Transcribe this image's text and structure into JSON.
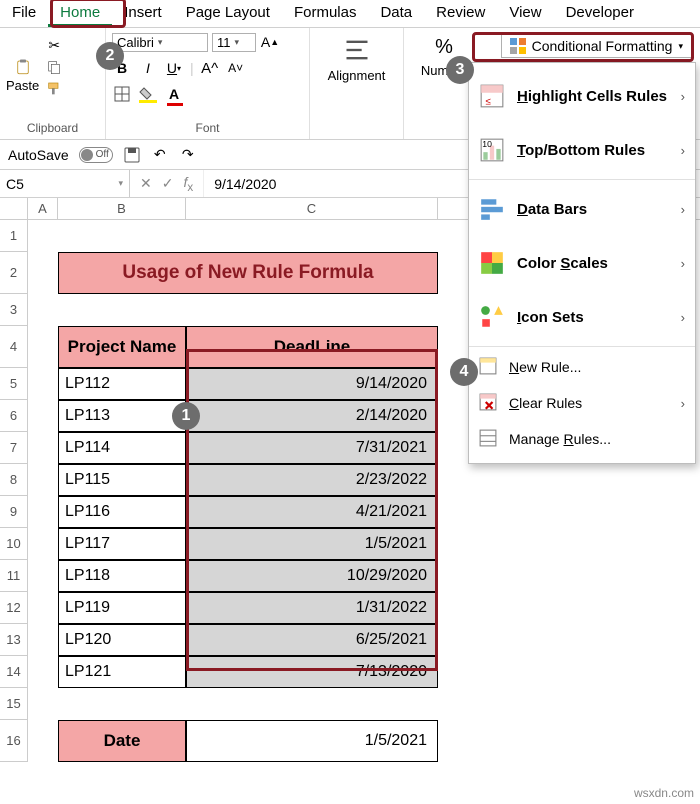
{
  "tabs": [
    "File",
    "Home",
    "Insert",
    "Page Layout",
    "Formulas",
    "Data",
    "Review",
    "View",
    "Developer"
  ],
  "activeTab": "Home",
  "groups": {
    "clipboard": "Clipboard",
    "font": "Font",
    "alignment": "Alignment",
    "number": "Number"
  },
  "paste_label": "Paste",
  "font_name": "Calibri",
  "font_size": "11",
  "cf_label": "Conditional Formatting",
  "autosave": "AutoSave",
  "autosave_state": "Off",
  "name_box": "C5",
  "formula": "9/14/2020",
  "columns": [
    "A",
    "B",
    "C"
  ],
  "rows": [
    "1",
    "2",
    "3",
    "4",
    "5",
    "6",
    "7",
    "8",
    "9",
    "10",
    "11",
    "12",
    "13",
    "14",
    "15",
    "16"
  ],
  "title": "Usage of New Rule Formula",
  "headers": {
    "b": "Project Name",
    "c": "DeadLine"
  },
  "data": [
    {
      "b": "LP112",
      "c": "9/14/2020"
    },
    {
      "b": "LP113",
      "c": "2/14/2020"
    },
    {
      "b": "LP114",
      "c": "7/31/2021"
    },
    {
      "b": "LP115",
      "c": "2/23/2022"
    },
    {
      "b": "LP116",
      "c": "4/21/2021"
    },
    {
      "b": "LP117",
      "c": "1/5/2021"
    },
    {
      "b": "LP118",
      "c": "10/29/2020"
    },
    {
      "b": "LP119",
      "c": "1/31/2022"
    },
    {
      "b": "LP120",
      "c": "6/25/2021"
    },
    {
      "b": "LP121",
      "c": "7/13/2020"
    }
  ],
  "date_label": "Date",
  "date_value": "1/5/2021",
  "menu": {
    "highlight": "Highlight Cells Rules",
    "topbottom": "Top/Bottom Rules",
    "databars": "Data Bars",
    "colorscales": "Color Scales",
    "iconsets": "Icon Sets",
    "newrule": "New Rule...",
    "clear": "Clear Rules",
    "manage": "Manage Rules..."
  },
  "badges": {
    "b1": "1",
    "b2": "2",
    "b3": "3",
    "b4": "4"
  },
  "watermark": "wsxdn.com"
}
